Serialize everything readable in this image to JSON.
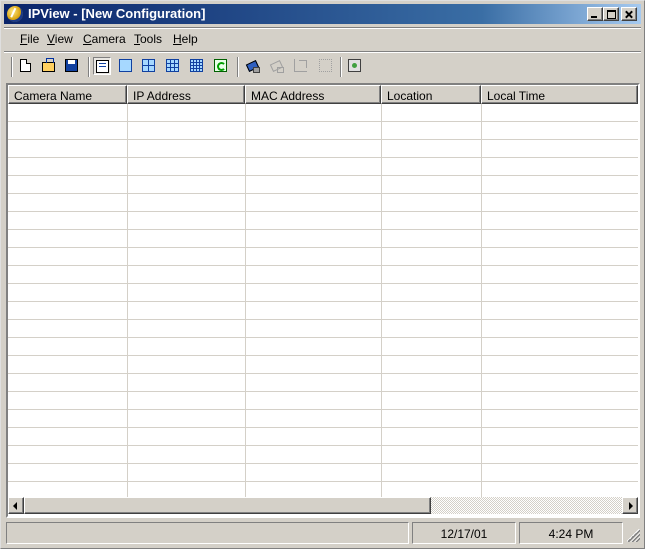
{
  "window": {
    "title": "IPView - [New Configuration]"
  },
  "menu": {
    "items": [
      "File",
      "View",
      "Camera",
      "Tools",
      "Help"
    ]
  },
  "toolbar": {
    "buttons": [
      {
        "icon": "new-document-icon"
      },
      {
        "icon": "open-folder-icon"
      },
      {
        "icon": "save-disk-icon"
      },
      {
        "icon": "list-view-icon",
        "pressed": true
      },
      {
        "icon": "single-view-icon"
      },
      {
        "icon": "quad-view-icon"
      },
      {
        "icon": "nine-view-icon"
      },
      {
        "icon": "sixteen-view-icon"
      },
      {
        "icon": "refresh-icon"
      },
      {
        "icon": "add-camera-icon"
      },
      {
        "icon": "remove-camera-icon",
        "disabled": true
      },
      {
        "icon": "edit-camera-icon",
        "disabled": true
      },
      {
        "icon": "delete-icon",
        "disabled": true
      },
      {
        "icon": "properties-icon"
      }
    ]
  },
  "table": {
    "columns": [
      "Camera Name",
      "IP Address",
      "MAC Address",
      "Location",
      "Local Time"
    ],
    "rows": []
  },
  "statusbar": {
    "message": "",
    "date": "12/17/01",
    "time": "4:24 PM"
  },
  "colors": {
    "title_active": "#0a246a",
    "face": "#d4d0c8"
  }
}
